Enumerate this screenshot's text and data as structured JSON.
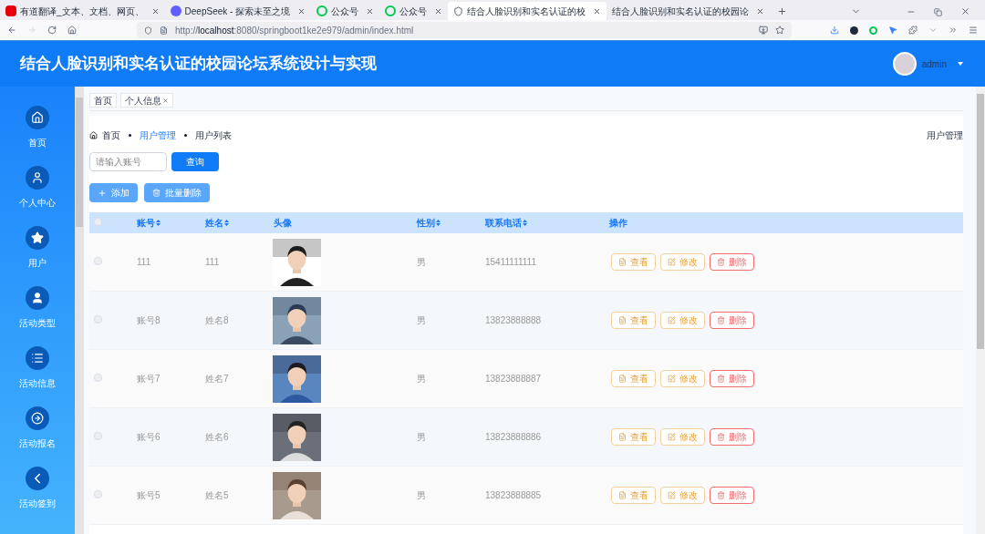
{
  "browser": {
    "tabs": [
      {
        "title": "有道翻译_文本、文档、网页、",
        "selected": false,
        "kind": "youdao"
      },
      {
        "title": "DeepSeek - 探索未至之境",
        "selected": false,
        "kind": "deepseek"
      },
      {
        "title": "公众号",
        "selected": false,
        "kind": "wechat"
      },
      {
        "title": "公众号",
        "selected": false,
        "kind": "wechat"
      },
      {
        "title": "结合人脸识别和实名认证的校",
        "selected": true,
        "kind": "shield"
      },
      {
        "title": "结合人脸识别和实名认证的校园论",
        "selected": false,
        "kind": "none"
      }
    ],
    "url_host": "localhost",
    "url_prefix": "http://",
    "url_rest": ":8080/springboot1ke2e979/admin/index.html"
  },
  "header": {
    "title": "结合人脸识别和实名认证的校园论坛系统设计与实现",
    "user": "admin"
  },
  "sidebar": {
    "items": [
      {
        "label": "首页"
      },
      {
        "label": "个人中心"
      },
      {
        "label": "用户"
      },
      {
        "label": "活动类型"
      },
      {
        "label": "活动信息"
      },
      {
        "label": "活动报名"
      },
      {
        "label": "活动签到"
      }
    ]
  },
  "page_tabs": [
    {
      "label": "首页",
      "closable": false
    },
    {
      "label": "个人信息",
      "closable": true
    }
  ],
  "breadcrumb": {
    "items": [
      {
        "label": "首页",
        "kind": "home"
      },
      {
        "label": "用户管理",
        "kind": "link"
      },
      {
        "label": "用户列表",
        "kind": "current"
      }
    ],
    "right": "用户管理"
  },
  "search": {
    "placeholder": "请输入账号",
    "button": "查询"
  },
  "actions": [
    {
      "label": "添加",
      "kind": "add"
    },
    {
      "label": "批量删除",
      "kind": "delete"
    }
  ],
  "table": {
    "columns": [
      {
        "label": "账号",
        "sortable": true
      },
      {
        "label": "姓名",
        "sortable": true
      },
      {
        "label": "头像",
        "sortable": false
      },
      {
        "label": "性别",
        "sortable": true
      },
      {
        "label": "联系电话",
        "sortable": true
      },
      {
        "label": "操作",
        "sortable": false
      }
    ],
    "header_checked": false,
    "rows": [
      {
        "checked": false,
        "account": "111",
        "name": "111",
        "gender": "男",
        "phone": "15411111111",
        "actions": [
          {
            "label": "查看",
            "kind": "view"
          },
          {
            "label": "修改",
            "kind": "edit"
          },
          {
            "label": "删除",
            "kind": "delete"
          }
        ]
      },
      {
        "checked": false,
        "account": "账号8",
        "name": "姓名8",
        "gender": "男",
        "phone": "13823888888",
        "actions": [
          {
            "label": "查看",
            "kind": "view"
          },
          {
            "label": "修改",
            "kind": "edit"
          },
          {
            "label": "删除",
            "kind": "delete"
          }
        ]
      },
      {
        "checked": false,
        "account": "账号7",
        "name": "姓名7",
        "gender": "男",
        "phone": "13823888887",
        "actions": [
          {
            "label": "查看",
            "kind": "view"
          },
          {
            "label": "修改",
            "kind": "edit"
          },
          {
            "label": "删除",
            "kind": "delete"
          }
        ]
      },
      {
        "checked": false,
        "account": "账号6",
        "name": "姓名6",
        "gender": "男",
        "phone": "13823888886",
        "actions": [
          {
            "label": "查看",
            "kind": "view"
          },
          {
            "label": "修改",
            "kind": "edit"
          },
          {
            "label": "删除",
            "kind": "delete"
          }
        ]
      },
      {
        "checked": false,
        "account": "账号5",
        "name": "姓名5",
        "gender": "男",
        "phone": "13823888885",
        "actions": [
          {
            "label": "查看",
            "kind": "view"
          },
          {
            "label": "修改",
            "kind": "edit"
          },
          {
            "label": "删除",
            "kind": "delete"
          }
        ]
      }
    ]
  }
}
